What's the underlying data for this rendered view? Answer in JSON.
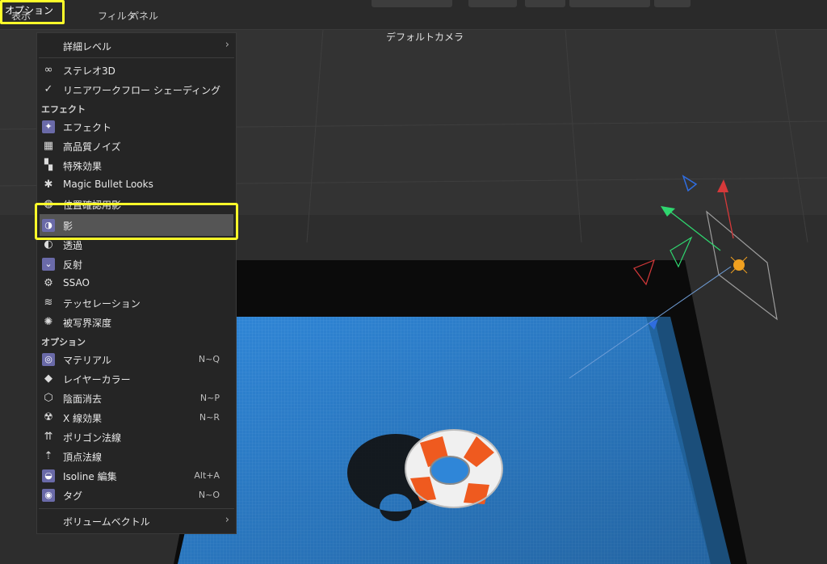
{
  "menubar": {
    "items": [
      "表示",
      "オプション",
      "フィルタ",
      "パネル"
    ]
  },
  "viewport": {
    "camera_label": "デフォルトカメラ"
  },
  "menu": {
    "items": [
      {
        "label": "詳細レベル",
        "submenu": true
      },
      {
        "label": "ステレオ3D",
        "icon": "stereo-glasses-icon"
      },
      {
        "label": "リニアワークフロー シェーディング",
        "icon": "checkmark-icon"
      },
      {
        "label": "エフェクト",
        "icon": "effect-icon"
      },
      {
        "label": "高品質ノイズ",
        "icon": "noise-icon"
      },
      {
        "label": "特殊効果",
        "icon": "clapper-icon"
      },
      {
        "label": "Magic Bullet Looks",
        "icon": "magic-bullet-icon"
      },
      {
        "label": "位置確認用影",
        "icon": "position-shadow-icon"
      },
      {
        "label": "影",
        "icon": "shadow-icon",
        "selected": true
      },
      {
        "label": "透過",
        "icon": "transparency-icon"
      },
      {
        "label": "反射",
        "icon": "reflection-icon"
      },
      {
        "label": "SSAO",
        "icon": "ssao-icon"
      },
      {
        "label": "テッセレーション",
        "icon": "tessellation-icon"
      },
      {
        "label": "被写界深度",
        "icon": "aperture-icon"
      },
      {
        "label": "マテリアル",
        "icon": "material-icon",
        "shortcut": "N~Q"
      },
      {
        "label": "レイヤーカラー",
        "icon": "layers-icon"
      },
      {
        "label": "陰面消去",
        "icon": "hidden-line-icon",
        "shortcut": "N~P"
      },
      {
        "label": "X 線効果",
        "icon": "xray-icon",
        "shortcut": "N~R"
      },
      {
        "label": "ポリゴン法線",
        "icon": "polygon-normals-icon"
      },
      {
        "label": "頂点法線",
        "icon": "vertex-normals-icon"
      },
      {
        "label": "Isoline 編集",
        "icon": "isoline-icon",
        "shortcut": "Alt+A"
      },
      {
        "label": "タグ",
        "icon": "tag-eye-icon",
        "shortcut": "N~O"
      },
      {
        "label": "ボリュームベクトル",
        "submenu": true
      }
    ],
    "section_effects": "エフェクト",
    "section_options": "オプション"
  },
  "colors": {
    "highlight_border": "#ffff2a",
    "floor_blue": "#2d86d6",
    "ring_orange": "#ef5a1f"
  }
}
